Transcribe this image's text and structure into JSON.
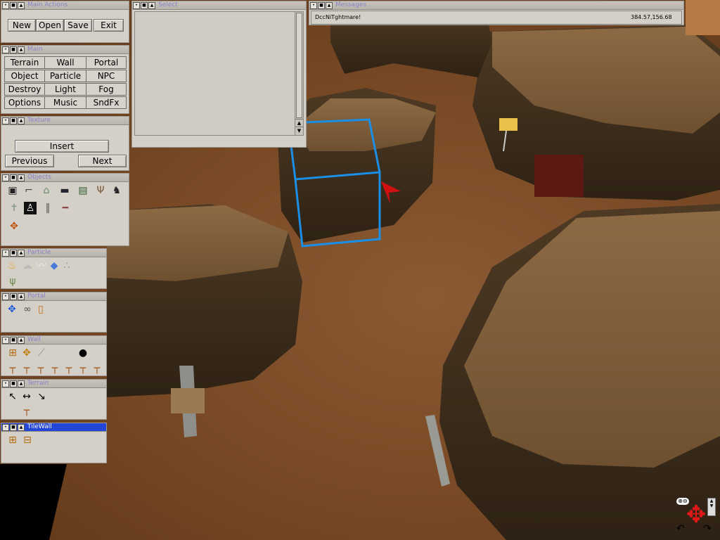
{
  "panels": {
    "main_actions": {
      "title": "Main Actions",
      "buttons": [
        "New",
        "Open",
        "Save",
        "Exit"
      ]
    },
    "main": {
      "title": "Main",
      "buttons": [
        "Terrain",
        "Wall",
        "Portal",
        "Object",
        "Particle",
        "NPC",
        "Destroy",
        "Light",
        "Fog",
        "Options",
        "Music",
        "SndFx"
      ]
    },
    "texture": {
      "title": "Texture",
      "insert_label": "Insert",
      "previous_label": "Previous",
      "next_label": "Next"
    },
    "objects": {
      "title": "Objects"
    },
    "particle": {
      "title": "Particle"
    },
    "portal": {
      "title": "Portal"
    },
    "wall": {
      "title": "Wall"
    },
    "terrain": {
      "title": "Terrain"
    },
    "tilewall": {
      "title": "TileWall"
    },
    "select": {
      "title": "Select"
    },
    "messages": {
      "title": "Messages",
      "message": "DccNiTghtmare!",
      "coords": "384.57,156.68"
    }
  },
  "icons": {
    "titlebar": [
      "minimize-icon",
      "restore-icon",
      "maximize-icon"
    ],
    "objects": [
      "computer-icon",
      "gun-icon",
      "house-icon",
      "car-icon",
      "picture-icon",
      "dead-tree-icon",
      "cow-icon",
      "gravestone-icon",
      "restroom-sign-icon",
      "road-icon",
      "plank-icon",
      "compass-icon"
    ],
    "particle": [
      "fire-icon",
      "smoke-icon",
      "cloud-icon",
      "blue-diamond-icon",
      "spray-icon",
      "grass-icon"
    ],
    "portal": [
      "move-arrows-icon",
      "link-icon",
      "door-icon"
    ],
    "wall": [
      "add-wall-icon",
      "wall-move-icon",
      "knife-icon",
      "bomb-icon",
      "wall-post-icon"
    ],
    "terrain": [
      "raise-terrain-icon",
      "flatten-terrain-icon",
      "lower-terrain-icon",
      "terrain-post-icon"
    ],
    "tilewall": [
      "add-tile-icon",
      "remove-tile-icon"
    ],
    "nav": [
      "zoom-icon",
      "move-arrows-icon",
      "rotate-left-icon",
      "rotate-right-icon",
      "scroll-down-icon"
    ]
  },
  "colors": {
    "panel_bg": "#d4d0c8",
    "title_text": "#8a80c6",
    "active_title_bg": "#2446d8",
    "selection_box": "#1b8ee8",
    "cursor": "#d01010"
  }
}
